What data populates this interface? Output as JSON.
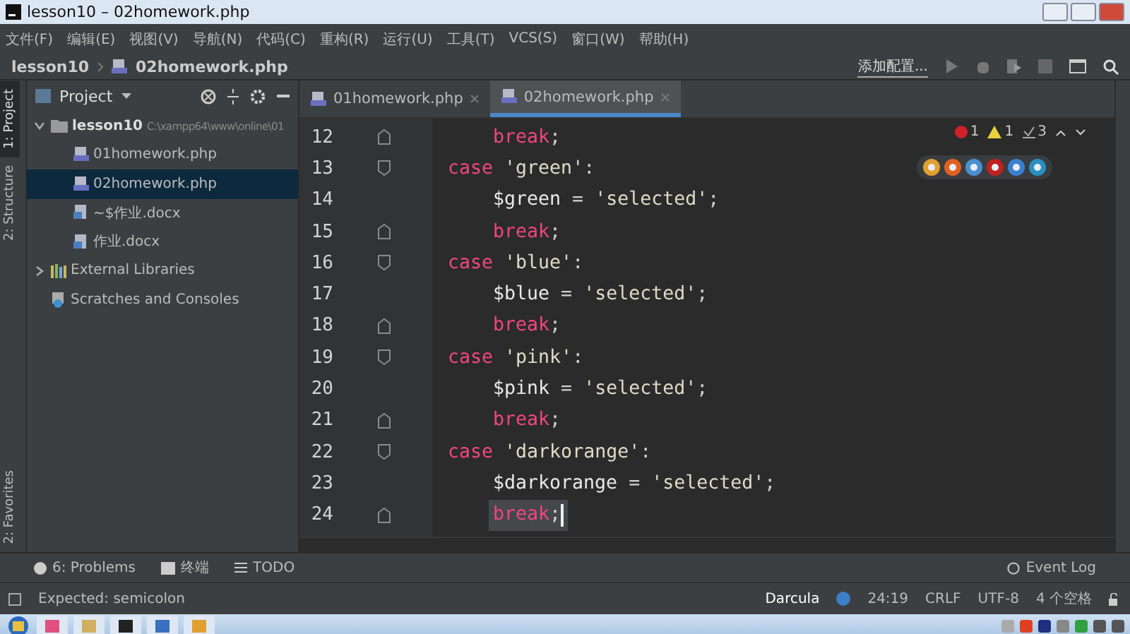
{
  "window": {
    "title": "lesson10 – 02homework.php"
  },
  "menu": [
    "文件(F)",
    "编辑(E)",
    "视图(V)",
    "导航(N)",
    "代码(C)",
    "重构(R)",
    "运行(U)",
    "工具(T)",
    "VCS(S)",
    "窗口(W)",
    "帮助(H)"
  ],
  "navbar": {
    "breadcrumbs": [
      "lesson10",
      "02homework.php"
    ],
    "run_config": "添加配置..."
  },
  "side_strip": {
    "top": [
      {
        "label": "1: Project",
        "selected": true
      },
      {
        "label": "2: Structure",
        "selected": false
      }
    ],
    "bottom": [
      {
        "label": "2: Favorites",
        "selected": false
      }
    ]
  },
  "project_panel": {
    "title": "Project",
    "tree": [
      {
        "label": "lesson10",
        "kind": "folder",
        "hint": "C:\\xampp64\\www\\online\\01",
        "expanded": true,
        "selected": false,
        "children": [
          {
            "label": "01homework.php",
            "kind": "php",
            "selected": false
          },
          {
            "label": "02homework.php",
            "kind": "php",
            "selected": true
          },
          {
            "label": "~$作业.docx",
            "kind": "docx",
            "selected": false
          },
          {
            "label": "作业.docx",
            "kind": "docx",
            "selected": false
          }
        ]
      },
      {
        "label": "External Libraries",
        "kind": "library",
        "expanded": false,
        "selected": false
      },
      {
        "label": "Scratches and Consoles",
        "kind": "scratches",
        "selected": false
      }
    ]
  },
  "editor": {
    "tabs": [
      {
        "label": "01homework.php",
        "selected": false
      },
      {
        "label": "02homework.php",
        "selected": true
      }
    ],
    "inspections": {
      "errors": "1",
      "warnings": "1",
      "weak_warnings": "3"
    },
    "lines": [
      {
        "number": "12",
        "kind": "statement",
        "fold_start": false,
        "fold_end": true,
        "current": false,
        "tokens": [
          {
            "kind": "keyword",
            "text": "break"
          },
          {
            "kind": "plain",
            "text": ";"
          }
        ]
      },
      {
        "number": "13",
        "kind": "case",
        "fold_start": true,
        "fold_end": false,
        "current": false,
        "tokens": [
          {
            "kind": "keyword",
            "text": "case "
          },
          {
            "kind": "string",
            "text": "'green'"
          },
          {
            "kind": "plain",
            "text": ":"
          }
        ]
      },
      {
        "number": "14",
        "kind": "statement",
        "fold_start": false,
        "fold_end": false,
        "current": false,
        "tokens": [
          {
            "kind": "variable",
            "text": "$green"
          },
          {
            "kind": "plain",
            "text": " = "
          },
          {
            "kind": "string",
            "text": "'selected'"
          },
          {
            "kind": "plain",
            "text": ";"
          }
        ]
      },
      {
        "number": "15",
        "kind": "statement",
        "fold_start": false,
        "fold_end": true,
        "current": false,
        "tokens": [
          {
            "kind": "keyword",
            "text": "break"
          },
          {
            "kind": "plain",
            "text": ";"
          }
        ]
      },
      {
        "number": "16",
        "kind": "case",
        "fold_start": true,
        "fold_end": false,
        "current": false,
        "tokens": [
          {
            "kind": "keyword",
            "text": "case "
          },
          {
            "kind": "string",
            "text": "'blue'"
          },
          {
            "kind": "plain",
            "text": ":"
          }
        ]
      },
      {
        "number": "17",
        "kind": "statement",
        "fold_start": false,
        "fold_end": false,
        "current": false,
        "tokens": [
          {
            "kind": "variable",
            "text": "$blue"
          },
          {
            "kind": "plain",
            "text": " = "
          },
          {
            "kind": "string",
            "text": "'selected'"
          },
          {
            "kind": "plain",
            "text": ";"
          }
        ]
      },
      {
        "number": "18",
        "kind": "statement",
        "fold_start": false,
        "fold_end": true,
        "current": false,
        "tokens": [
          {
            "kind": "keyword",
            "text": "break"
          },
          {
            "kind": "plain",
            "text": ";"
          }
        ]
      },
      {
        "number": "19",
        "kind": "case",
        "fold_start": true,
        "fold_end": false,
        "current": false,
        "tokens": [
          {
            "kind": "keyword",
            "text": "case "
          },
          {
            "kind": "string",
            "text": "'pink'"
          },
          {
            "kind": "plain",
            "text": ":"
          }
        ]
      },
      {
        "number": "20",
        "kind": "statement",
        "fold_start": false,
        "fold_end": false,
        "current": false,
        "tokens": [
          {
            "kind": "variable",
            "text": "$pink"
          },
          {
            "kind": "plain",
            "text": " = "
          },
          {
            "kind": "string",
            "text": "'selected'"
          },
          {
            "kind": "plain",
            "text": ";"
          }
        ]
      },
      {
        "number": "21",
        "kind": "statement",
        "fold_start": false,
        "fold_end": true,
        "current": false,
        "tokens": [
          {
            "kind": "keyword",
            "text": "break"
          },
          {
            "kind": "plain",
            "text": ";"
          }
        ]
      },
      {
        "number": "22",
        "kind": "case",
        "fold_start": true,
        "fold_end": false,
        "current": false,
        "tokens": [
          {
            "kind": "keyword",
            "text": "case "
          },
          {
            "kind": "string",
            "text": "'darkorange'"
          },
          {
            "kind": "plain",
            "text": ":"
          }
        ]
      },
      {
        "number": "23",
        "kind": "statement",
        "fold_start": false,
        "fold_end": false,
        "current": false,
        "tokens": [
          {
            "kind": "variable",
            "text": "$darkorange"
          },
          {
            "kind": "plain",
            "text": " = "
          },
          {
            "kind": "string",
            "text": "'selected'"
          },
          {
            "kind": "plain",
            "text": ";"
          }
        ]
      },
      {
        "number": "24",
        "kind": "statement",
        "fold_start": false,
        "fold_end": true,
        "current": true,
        "tokens": [
          {
            "kind": "keyword",
            "text": "break"
          },
          {
            "kind": "plain",
            "text": ";"
          }
        ]
      }
    ]
  },
  "tool_tabs": {
    "left": [
      "6: Problems",
      "终端",
      "TODO"
    ],
    "right": [
      "Event Log"
    ]
  },
  "status_bar": {
    "message": "Expected: semicolon",
    "theme": "Darcula",
    "position": "24:19",
    "line_separator": "CRLF",
    "encoding": "UTF-8",
    "indent": "4 个空格"
  }
}
